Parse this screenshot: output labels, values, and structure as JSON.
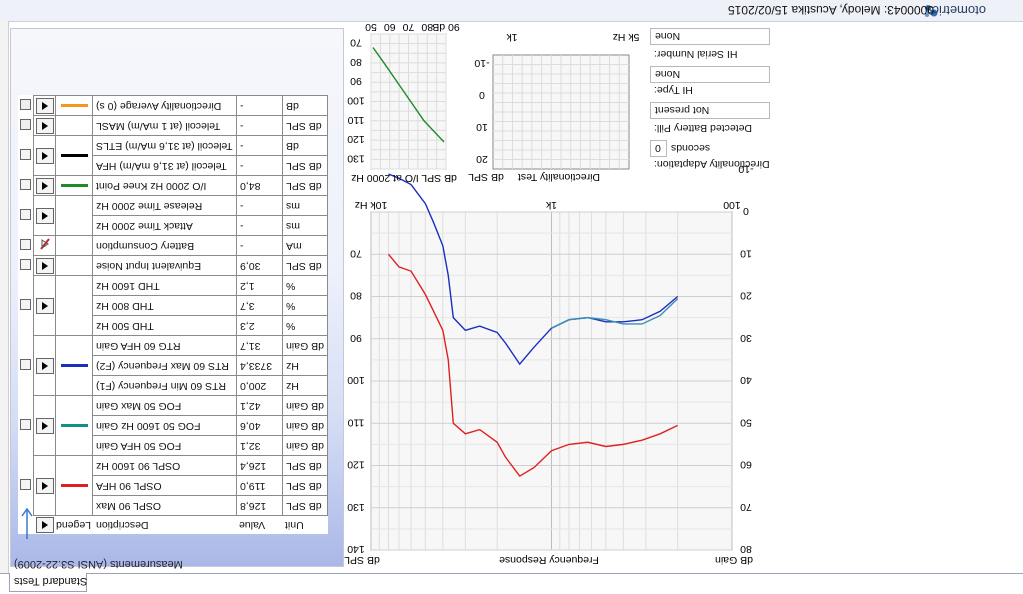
{
  "header": {
    "brand": "otometrics",
    "patient": "0000043: Melody, Acustika   15/02/2015"
  },
  "panel": {
    "title": "Measurements (ANSI S3.22-2009)",
    "tab": "Standard Tests"
  },
  "table": {
    "headers": {
      "legend": "Legend",
      "description": "Description",
      "value": "Value",
      "unit": "Unit"
    },
    "rows": [
      {
        "desc": "OSPL 90 Max",
        "value": "126,8",
        "unit": "dB SPL"
      },
      {
        "desc": "OSPL 90 HFA",
        "value": "119,0",
        "unit": "dB SPL"
      },
      {
        "desc": "OSPL 90 1600 Hz",
        "value": "126,4",
        "unit": "dB SPL"
      },
      {
        "desc": "FOG 50 HFA Gain",
        "value": "32,1",
        "unit": "dB Gain"
      },
      {
        "desc": "FOG 50 1600 Hz Gain",
        "value": "40,6",
        "unit": "dB Gain"
      },
      {
        "desc": "FOG 50 Max Gain",
        "value": "42,1",
        "unit": "dB Gain"
      },
      {
        "desc": "RTS 60 Min Frequency (F1)",
        "value": "200,0",
        "unit": "Hz"
      },
      {
        "desc": "RTS 60 Max Frequency (F2)",
        "value": "3733,4",
        "unit": "Hz"
      },
      {
        "desc": "RTG 60 HFA Gain",
        "value": "31,7",
        "unit": "dB Gain"
      },
      {
        "desc": "THD 500 Hz",
        "value": "2,3",
        "unit": "%"
      },
      {
        "desc": "THD 800 Hz",
        "value": "3,7",
        "unit": "%"
      },
      {
        "desc": "THD 1600 Hz",
        "value": "1,2",
        "unit": "%"
      },
      {
        "desc": "Equivalent Input Noise",
        "value": "30,9",
        "unit": "dB SPL"
      },
      {
        "desc": "Battery Consumption",
        "value": "-",
        "unit": "mA"
      },
      {
        "desc": "Attack Time 2000 Hz",
        "value": "-",
        "unit": "ms"
      },
      {
        "desc": "Release Time 2000 Hz",
        "value": "-",
        "unit": "ms"
      },
      {
        "desc": "I/O 2000 Hz Knee Point",
        "value": "84,0",
        "unit": "dB SPL"
      },
      {
        "desc": "Telecoil (at 31,6 mA/m) HFA",
        "value": "-",
        "unit": "dB SPL"
      },
      {
        "desc": "Telecoil (at 31,6 mA/m) ETLS",
        "value": "-",
        "unit": "dB"
      },
      {
        "desc": "Telecoil (at 1 mA/m) MASL",
        "value": "-",
        "unit": "dB SPL"
      },
      {
        "desc": "Directionality Average (0 s)",
        "value": "-",
        "unit": "dB"
      }
    ],
    "legend_colors": {
      "red": "#e02020",
      "teal": "#138f8a",
      "blue": "#1a2fbf",
      "green": "#1f8a2a",
      "black": "#000000",
      "orange": "#f39a1e"
    }
  },
  "info": {
    "directionality_label": "Directionality Adaptation:",
    "directionality_value": "0",
    "directionality_unit": "seconds",
    "battery_label": "Detected Battery Pill:",
    "battery_value": "Not present",
    "hi_type_label": "HI Type:",
    "hi_type_value": "None",
    "hi_serial_label": "HI Serial Number:",
    "hi_serial_value": "None"
  },
  "chart_data": [
    {
      "type": "line",
      "title": "Frequency Response",
      "xlabel": "Frequency Response",
      "ylabel": "dB SPL",
      "ylabel_right": "dB Gain",
      "x_ticks": [
        "100",
        "1k",
        "10k Hz"
      ],
      "y_ticks_left": [
        "140",
        "130",
        "120",
        "110",
        "100",
        "90",
        "80",
        "70"
      ],
      "y_ticks_right": [
        "80",
        "70",
        "60",
        "50",
        "40",
        "30",
        "20",
        "10",
        "0",
        "-10"
      ],
      "ylim": [
        60,
        140
      ],
      "series": [
        {
          "color": "#e02020",
          "x": [
            200,
            250,
            315,
            400,
            500,
            630,
            800,
            1000,
            1250,
            1500,
            1800,
            2000,
            2500,
            3000,
            3500,
            3733,
            4000,
            4500,
            5000,
            6000,
            7000,
            8000
          ],
          "y": [
            110.5,
            112.5,
            114,
            115,
            115.5,
            114.5,
            115,
            116.5,
            120.5,
            122.5,
            118,
            114.5,
            111.5,
            112.5,
            110,
            95,
            88,
            83.5,
            79.5,
            74,
            73,
            70
          ]
        },
        {
          "color": "#1a2fbf",
          "x": [
            200,
            250,
            315,
            400,
            500,
            630,
            800,
            1000,
            1250,
            1500,
            1800,
            2000,
            2500,
            3000,
            3500,
            3733,
            4000,
            4500,
            5000,
            6000,
            7000,
            8000
          ],
          "y": [
            80,
            83.5,
            85.5,
            86,
            86,
            85,
            85.5,
            87.5,
            92,
            96,
            91,
            88.5,
            87,
            88,
            85,
            75,
            68,
            62.5,
            58,
            53.5,
            52,
            51
          ]
        },
        {
          "color": "#3a8fb8",
          "x": [
            200,
            250,
            315,
            400,
            500,
            630,
            800,
            1000
          ],
          "y": [
            80.5,
            84.5,
            86.5,
            86.5,
            85.5,
            85,
            85.5,
            87.5
          ]
        }
      ]
    },
    {
      "type": "line",
      "title": "dB SPL I/O at 2000 Hz",
      "xlabel": "dB SPL I/O at 2000 Hz",
      "x_ticks": [
        "50",
        "60",
        "70",
        "80",
        "90 dB"
      ],
      "y_ticks": [
        "130",
        "120",
        "110",
        "100",
        "90",
        "80",
        "70"
      ],
      "series": [
        {
          "color": "#1f8a2a",
          "x": [
            50,
            90
          ],
          "y": [
            72,
            123
          ]
        }
      ]
    },
    {
      "type": "line",
      "title": "Directionality Test",
      "xlabel": "Directionality Test",
      "ylabel": "dB SPL",
      "x_ticks": [
        "1k",
        "5k Hz"
      ],
      "y_ticks": [
        "20",
        "10",
        "0",
        "-10"
      ],
      "series": []
    }
  ]
}
